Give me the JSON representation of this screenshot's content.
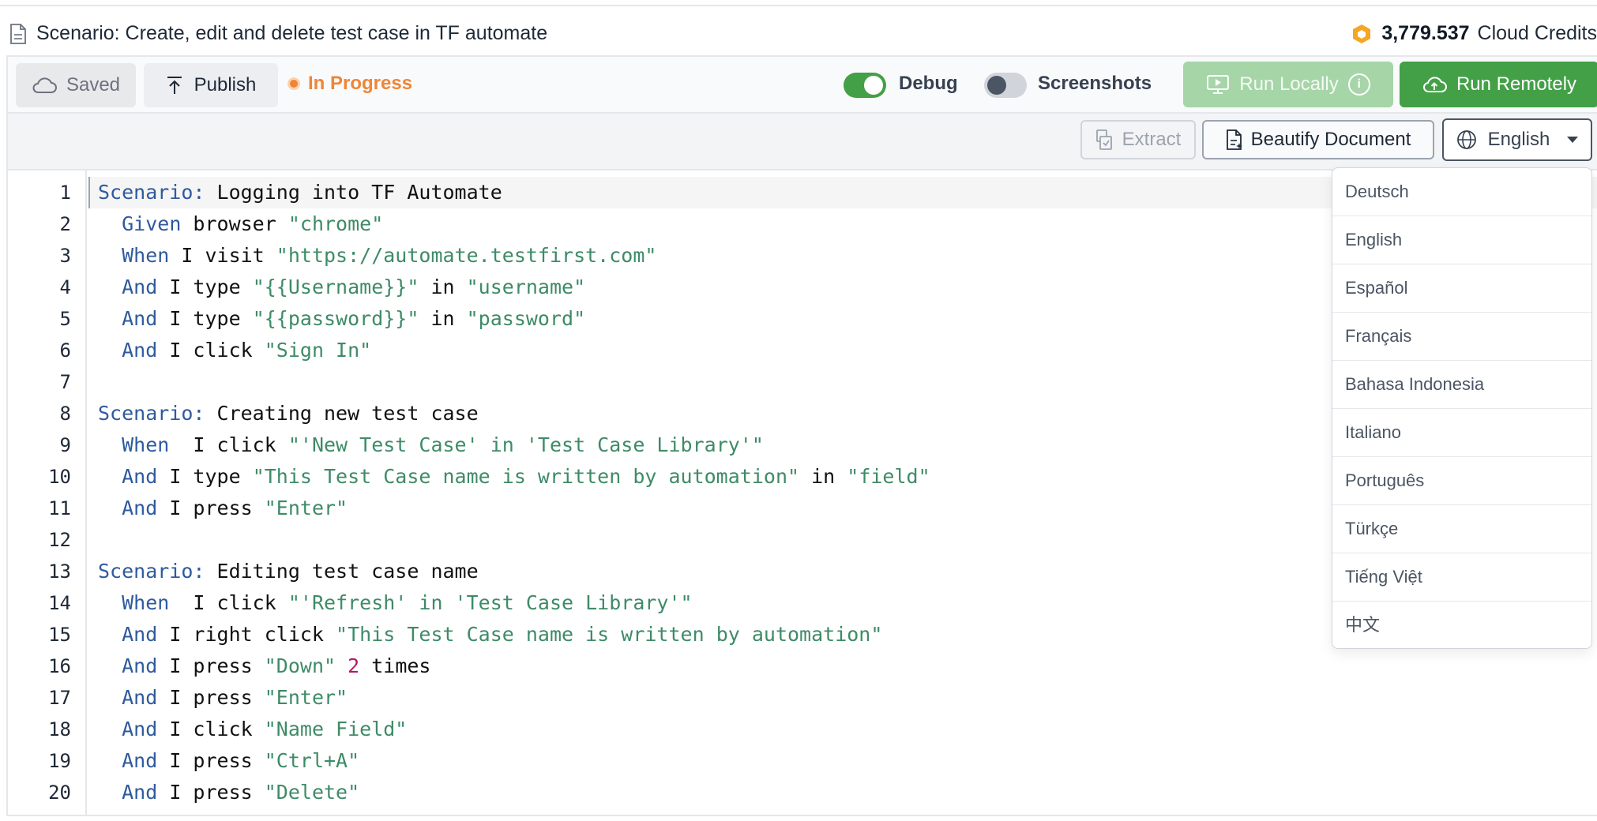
{
  "header": {
    "title": "Scenario: Create, edit and delete test case in TF automate",
    "credits_amount": "3,779.537",
    "credits_label": "Cloud Credits"
  },
  "toolbar": {
    "saved_label": "Saved",
    "publish_label": "Publish",
    "status_label": "In Progress",
    "debug_label": "Debug",
    "debug_on": true,
    "screenshots_label": "Screenshots",
    "screenshots_on": false,
    "run_locally_label": "Run Locally",
    "run_remotely_label": "Run Remotely"
  },
  "subtoolbar": {
    "extract_label": "Extract",
    "beautify_label": "Beautify Document",
    "language_label": "English"
  },
  "language_menu": {
    "options": [
      "Deutsch",
      "English",
      "Español",
      "Français",
      "Bahasa Indonesia",
      "Italiano",
      "Português",
      "Türkçe",
      "Tiếng Việt",
      "中文"
    ]
  },
  "editor": {
    "line_numbers": [
      "1",
      "2",
      "3",
      "4",
      "5",
      "6",
      "7",
      "8",
      "9",
      "10",
      "11",
      "12",
      "13",
      "14",
      "15",
      "16",
      "17",
      "18",
      "19",
      "20"
    ],
    "lines": [
      [
        [
          "kw",
          "Scenario:"
        ],
        [
          "txt",
          " Logging into TF Automate"
        ]
      ],
      [
        [
          "txt",
          "  "
        ],
        [
          "kw",
          "Given"
        ],
        [
          "txt",
          " browser "
        ],
        [
          "str",
          "\"chrome\""
        ]
      ],
      [
        [
          "txt",
          "  "
        ],
        [
          "kw",
          "When"
        ],
        [
          "txt",
          " I visit "
        ],
        [
          "str",
          "\"https://automate.testfirst.com\""
        ]
      ],
      [
        [
          "txt",
          "  "
        ],
        [
          "kw",
          "And"
        ],
        [
          "txt",
          " I type "
        ],
        [
          "str",
          "\"{{Username}}\""
        ],
        [
          "txt",
          " in "
        ],
        [
          "str",
          "\"username\""
        ]
      ],
      [
        [
          "txt",
          "  "
        ],
        [
          "kw",
          "And"
        ],
        [
          "txt",
          " I type "
        ],
        [
          "str",
          "\"{{password}}\""
        ],
        [
          "txt",
          " in "
        ],
        [
          "str",
          "\"password\""
        ]
      ],
      [
        [
          "txt",
          "  "
        ],
        [
          "kw",
          "And"
        ],
        [
          "txt",
          " I click "
        ],
        [
          "str",
          "\"Sign In\""
        ]
      ],
      [],
      [
        [
          "kw",
          "Scenario:"
        ],
        [
          "txt",
          " Creating new test case"
        ]
      ],
      [
        [
          "txt",
          "  "
        ],
        [
          "kw",
          "When"
        ],
        [
          "txt",
          "  I click "
        ],
        [
          "str",
          "\"'New Test Case' in 'Test Case Library'\""
        ]
      ],
      [
        [
          "txt",
          "  "
        ],
        [
          "kw",
          "And"
        ],
        [
          "txt",
          " I type "
        ],
        [
          "str",
          "\"This Test Case name is written by automation\""
        ],
        [
          "txt",
          " in "
        ],
        [
          "str",
          "\"field\""
        ]
      ],
      [
        [
          "txt",
          "  "
        ],
        [
          "kw",
          "And"
        ],
        [
          "txt",
          " I press "
        ],
        [
          "str",
          "\"Enter\""
        ]
      ],
      [],
      [
        [
          "kw",
          "Scenario:"
        ],
        [
          "txt",
          " Editing test case name"
        ]
      ],
      [
        [
          "txt",
          "  "
        ],
        [
          "kw",
          "When"
        ],
        [
          "txt",
          "  I click "
        ],
        [
          "str",
          "\"'Refresh' in 'Test Case Library'\""
        ]
      ],
      [
        [
          "txt",
          "  "
        ],
        [
          "kw",
          "And"
        ],
        [
          "txt",
          " I right click "
        ],
        [
          "str",
          "\"This Test Case name is written by automation\""
        ]
      ],
      [
        [
          "txt",
          "  "
        ],
        [
          "kw",
          "And"
        ],
        [
          "txt",
          " I press "
        ],
        [
          "str",
          "\"Down\""
        ],
        [
          "txt",
          " "
        ],
        [
          "num",
          "2"
        ],
        [
          "txt",
          " times"
        ]
      ],
      [
        [
          "txt",
          "  "
        ],
        [
          "kw",
          "And"
        ],
        [
          "txt",
          " I press "
        ],
        [
          "str",
          "\"Enter\""
        ]
      ],
      [
        [
          "txt",
          "  "
        ],
        [
          "kw",
          "And"
        ],
        [
          "txt",
          " I click "
        ],
        [
          "str",
          "\"Name Field\""
        ]
      ],
      [
        [
          "txt",
          "  "
        ],
        [
          "kw",
          "And"
        ],
        [
          "txt",
          " I press "
        ],
        [
          "str",
          "\"Ctrl+A\""
        ]
      ],
      [
        [
          "txt",
          "  "
        ],
        [
          "kw",
          "And"
        ],
        [
          "txt",
          " I press "
        ],
        [
          "str",
          "\"Delete\""
        ]
      ]
    ]
  },
  "colors": {
    "accent_green": "#43a047",
    "status_orange": "#f08535",
    "keyword_blue": "#2e5a9e",
    "string_green": "#3e8b67",
    "number_magenta": "#b5176a"
  }
}
